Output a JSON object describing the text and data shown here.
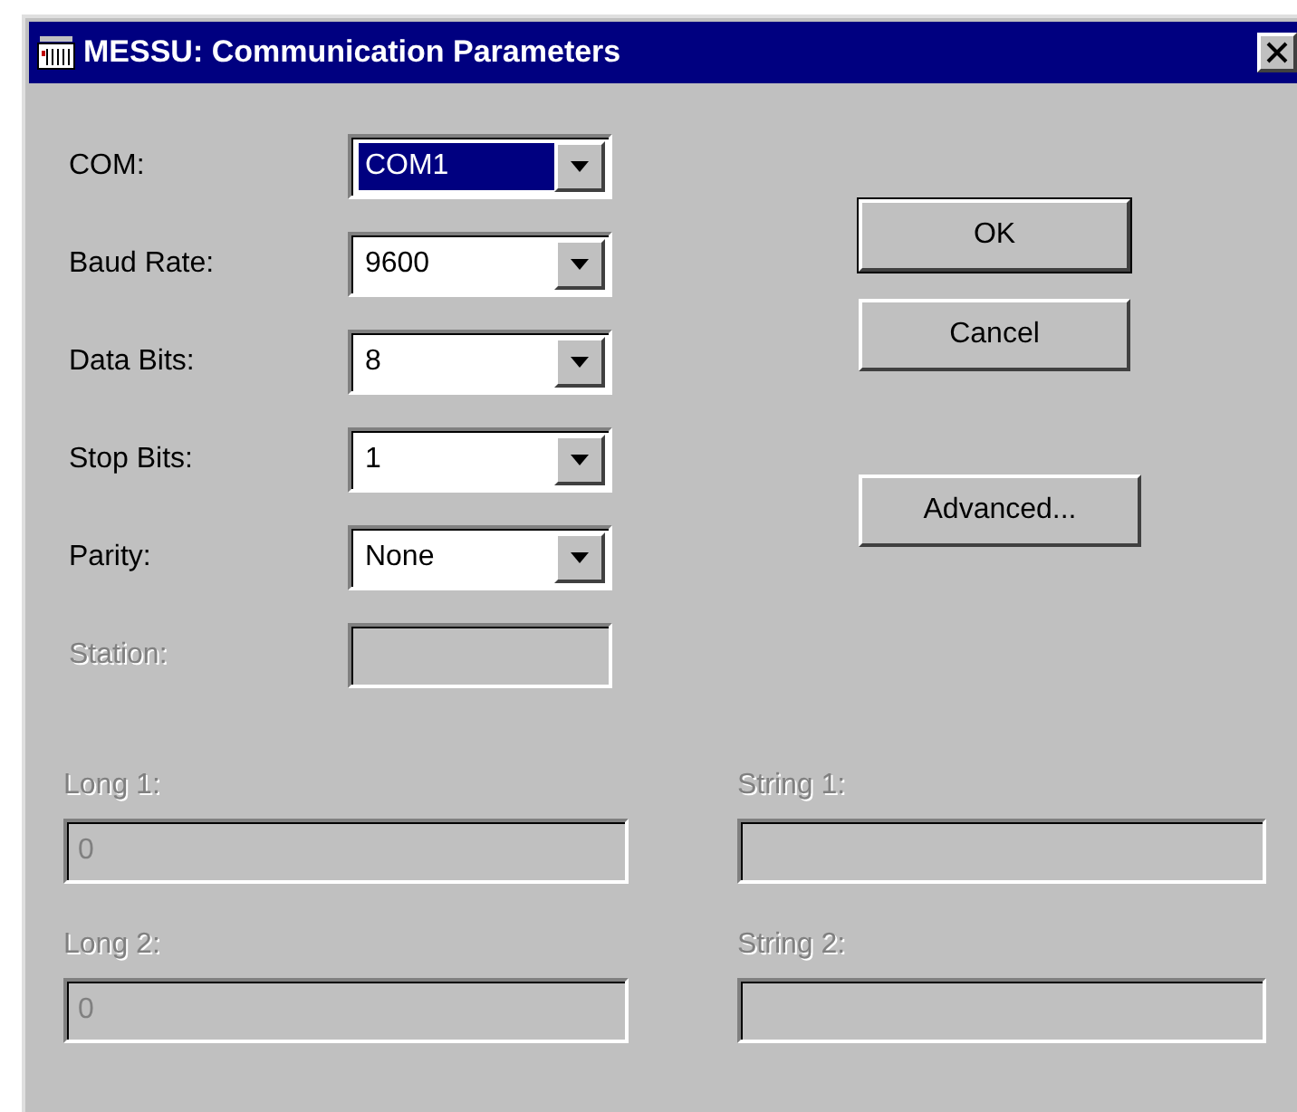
{
  "window": {
    "title": "MESSU: Communication Parameters"
  },
  "settings": [
    {
      "label": "COM:",
      "kind": "combo",
      "value": "COM1",
      "selected": true,
      "disabled": false
    },
    {
      "label": "Baud Rate:",
      "kind": "combo",
      "value": "9600",
      "selected": false,
      "disabled": false
    },
    {
      "label": "Data Bits:",
      "kind": "combo",
      "value": "8",
      "selected": false,
      "disabled": false
    },
    {
      "label": "Stop Bits:",
      "kind": "combo",
      "value": "1",
      "selected": false,
      "disabled": false
    },
    {
      "label": "Parity:",
      "kind": "combo",
      "value": "None",
      "selected": false,
      "disabled": false
    },
    {
      "label": "Station:",
      "kind": "text",
      "selected": false,
      "disabled": true
    }
  ],
  "buttons": [
    {
      "label": "OK",
      "default": true
    },
    {
      "label": "Cancel",
      "default": false
    },
    {
      "label": "Advanced...",
      "default": false
    }
  ],
  "extra_fields": [
    {
      "label": "Long 1:",
      "value": "0",
      "disabled": true
    },
    {
      "label": "String 1:",
      "disabled": true
    },
    {
      "label": "Long 2:",
      "value": "0",
      "disabled": true
    },
    {
      "label": "String 2:",
      "disabled": true
    }
  ]
}
